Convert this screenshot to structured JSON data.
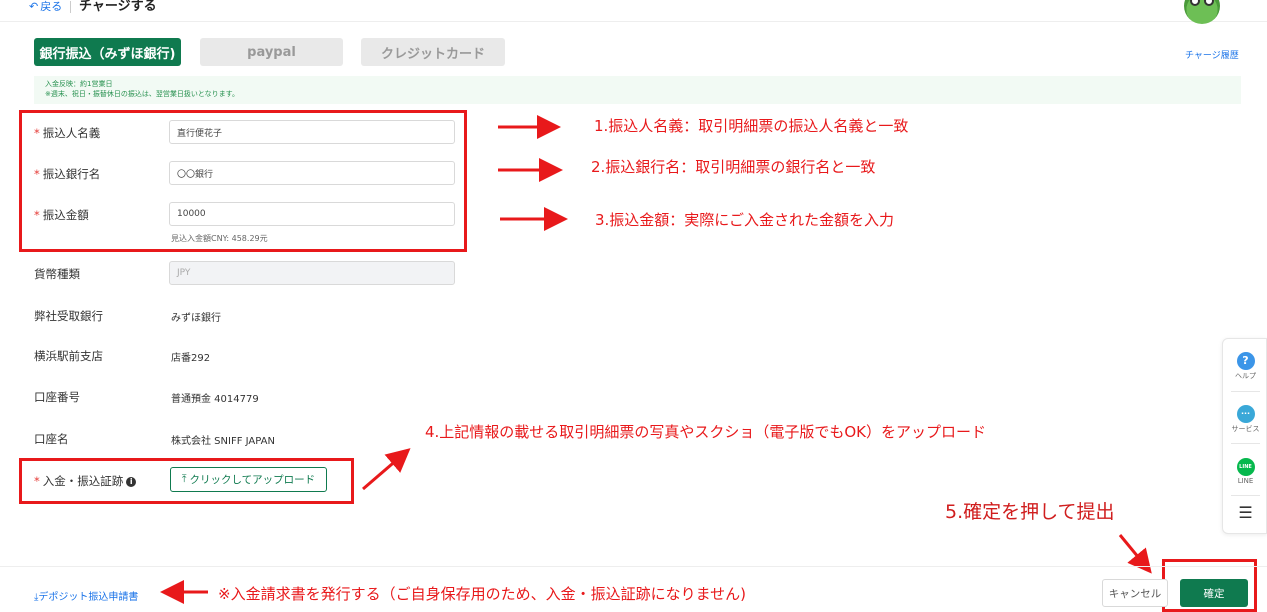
{
  "header": {
    "back_icon": "undo-arrow-icon",
    "back_label": "戻る",
    "title": "チャージする"
  },
  "tabs": [
    {
      "label": "銀行振込（みずほ銀行)",
      "active": true
    },
    {
      "label": "paypal",
      "active": false
    },
    {
      "label": "クレジットカード",
      "active": false
    }
  ],
  "history_link": "チャージ履歴",
  "notice": {
    "line1": "入金反映：約1営業日",
    "line2": "※週末、祝日・振替休日の振込は、翌営業日扱いとなります。"
  },
  "form": {
    "payer_name": {
      "label": "振込人名義",
      "value": "直行便花子"
    },
    "bank_name": {
      "label": "振込銀行名",
      "value": "〇〇銀行"
    },
    "amount": {
      "label": "振込金額",
      "value": "10000",
      "hint": "見込入金額CNY: 458.29元"
    },
    "currency": {
      "label": "貨幣種類",
      "value": "JPY"
    },
    "receiving_bank": {
      "label": "弊社受取銀行",
      "value": "みずほ銀行"
    },
    "branch": {
      "label": "横浜駅前支店",
      "value": "店番292"
    },
    "account_number": {
      "label": "口座番号",
      "value": "普通預金 4014779"
    },
    "account_name": {
      "label": "口座名",
      "value": "株式会社 SNIFF JAPAN"
    },
    "proof": {
      "label": "入金・振込証跡",
      "info_icon": "i",
      "upload_label": "クリックしてアップロード"
    }
  },
  "annotations": {
    "note1": "1.振込人名義：取引明細票の振込人名義と一致",
    "note2": "2.振込銀行名：取引明細票の銀行名と一致",
    "note3": "3.振込金額：実際にご入金された金額を入力",
    "note4": "4.上記情報の載せる取引明細票の写真やスクショ（電子版でもOK）をアップロード",
    "note5": "5.確定を押して提出",
    "note_footer": "※入金請求書を発行する（ご自身保存用のため、入金・振込証跡になりません)"
  },
  "footer": {
    "deposit_link": "デポジット振込申請書",
    "cancel_label": "キャンセル",
    "confirm_label": "確定"
  },
  "side_widget": {
    "help": {
      "glyph": "?",
      "label": "ヘルプ"
    },
    "service": {
      "glyph": "···",
      "label": "サービス"
    },
    "line": {
      "glyph": "LINE",
      "label": "LINE"
    },
    "menu_icon": "collapse-menu-icon"
  },
  "colors": {
    "primary_green": "#0f7a4f",
    "annotation_red": "#e8191b",
    "link_blue": "#1a73e8"
  }
}
